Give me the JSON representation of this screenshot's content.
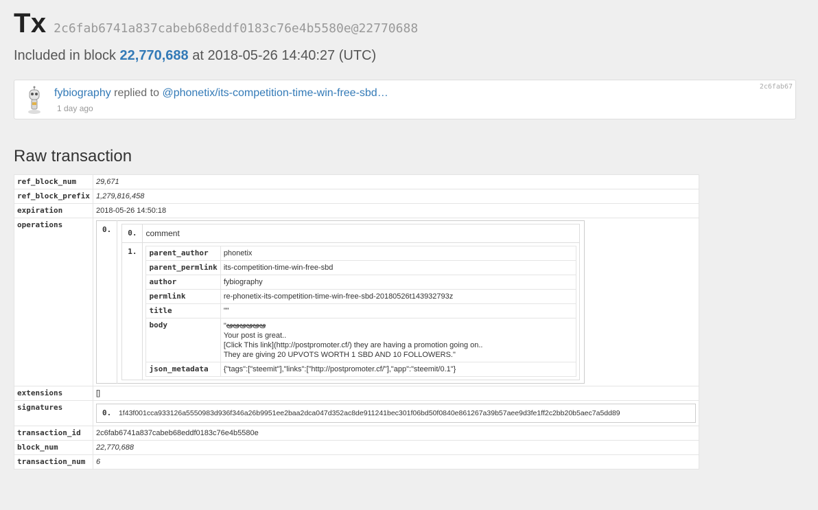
{
  "header": {
    "title": "Tx",
    "tx_ref": "2c6fab6741a837cabeb68eddf0183c76e4b5580e@22770688"
  },
  "included": {
    "prefix": "Included in block",
    "block": "22,770,688",
    "at": "at",
    "datetime": "2018-05-26 14:40:27 (UTC)"
  },
  "card": {
    "author": "fybiography",
    "action": "replied to",
    "target": "@phonetix/its-competition-time-win-free-sbd…",
    "time_ago": "1 day ago",
    "short_id": "2c6fab67",
    "avatar_icon": "robot-avatar-icon"
  },
  "raw": {
    "title": "Raw transaction",
    "ref_block_num": {
      "key": "ref_block_num",
      "value": "29,671"
    },
    "ref_block_prefix": {
      "key": "ref_block_prefix",
      "value": "1,279,816,458"
    },
    "expiration": {
      "key": "expiration",
      "value": "2018-05-26 14:50:18"
    },
    "operations": {
      "key": "operations",
      "idx": "0.",
      "op_idx": "0.",
      "op_type": "comment",
      "params_idx": "1.",
      "parent_author": {
        "key": "parent_author",
        "value": "phonetix"
      },
      "parent_permlink": {
        "key": "parent_permlink",
        "value": "its-competition-time-win-free-sbd"
      },
      "author": {
        "key": "author",
        "value": "fybiography"
      },
      "permlink": {
        "key": "permlink",
        "value": "re-phonetix-its-competition-time-win-free-sbd-20180526t143932793z"
      },
      "title": {
        "key": "title",
        "value": "\"\""
      },
      "body": {
        "key": "body",
        "line1_quote": "\"",
        "line1_strike": "ఆఆఆఆఆఆ",
        "line2": "Your post is great..",
        "line3": "[Click This link](http://postpromoter.cf/) they are having a promotion going on..",
        "line4": "They are giving 20 UPVOTS WORTH 1 SBD AND 10 FOLLOWERS.\""
      },
      "json_metadata": {
        "key": "json_metadata",
        "value": "{\"tags\":[\"steemit\"],\"links\":[\"http://postpromoter.cf/\"],\"app\":\"steemit/0.1\"}"
      }
    },
    "extensions": {
      "key": "extensions",
      "value": "[]"
    },
    "signatures": {
      "key": "signatures",
      "idx": "0.",
      "value": "1f43f001cca933126a5550983d936f346a26b9951ee2baa2dca047d352ac8de911241bec301f06bd50f0840e861267a39b57aee9d3fe1ff2c2bb20b5aec7a5dd89"
    },
    "transaction_id": {
      "key": "transaction_id",
      "value": "2c6fab6741a837cabeb68eddf0183c76e4b5580e"
    },
    "block_num": {
      "key": "block_num",
      "value": "22,770,688"
    },
    "transaction_num": {
      "key": "transaction_num",
      "value": "6"
    }
  }
}
